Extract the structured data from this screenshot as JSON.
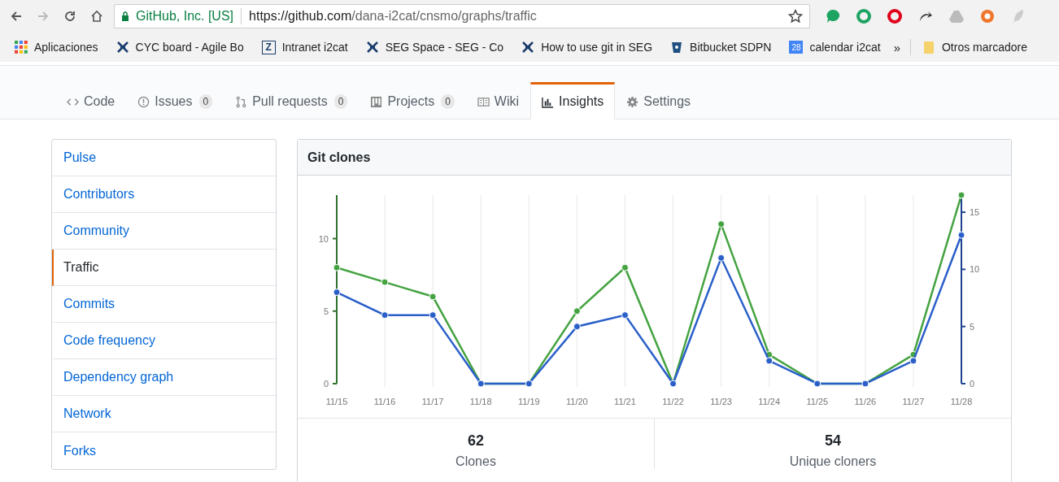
{
  "browser": {
    "site_identity": "GitHub, Inc. [US]",
    "url_host": "https://github.com",
    "url_path": "/dana-i2cat/cnsmo/graphs/traffic",
    "extensions": [
      {
        "kind": "bubble"
      },
      {
        "kind": "dring"
      },
      {
        "kind": "oring"
      },
      {
        "kind": "arrow"
      },
      {
        "kind": "drive"
      },
      {
        "kind": "lifebuoy"
      },
      {
        "kind": "feather"
      }
    ]
  },
  "bookmarks": [
    {
      "kind": "apps",
      "label": "Aplicaciones"
    },
    {
      "kind": "bug",
      "label": "CYC board - Agile Bo"
    },
    {
      "kind": "z",
      "label": "Intranet i2cat",
      "glyph": "Z"
    },
    {
      "kind": "bug",
      "label": "SEG Space - SEG - Co"
    },
    {
      "kind": "bug",
      "label": "How to use git in SEG"
    },
    {
      "kind": "bucket",
      "label": "Bitbucket SDPN"
    },
    {
      "kind": "calendar",
      "label": "calendar i2cat",
      "glyph": "28"
    }
  ],
  "bookmarks_more": "»",
  "other_bookmarks": "Otros marcadore",
  "tabs": [
    {
      "kind": "code",
      "label": "Code",
      "selected": false
    },
    {
      "kind": "issue",
      "label": "Issues",
      "count": "0",
      "selected": false
    },
    {
      "kind": "pr",
      "label": "Pull requests",
      "count": "0",
      "selected": false
    },
    {
      "kind": "project",
      "label": "Projects",
      "count": "0",
      "selected": false
    },
    {
      "kind": "wiki",
      "label": "Wiki",
      "selected": false
    },
    {
      "kind": "graph",
      "label": "Insights",
      "selected": true
    },
    {
      "kind": "gear",
      "label": "Settings",
      "selected": false
    }
  ],
  "sidebar": {
    "items": [
      {
        "label": "Pulse",
        "selected": false
      },
      {
        "label": "Contributors",
        "selected": false
      },
      {
        "label": "Community",
        "selected": false
      },
      {
        "label": "Traffic",
        "selected": true
      },
      {
        "label": "Commits",
        "selected": false
      },
      {
        "label": "Code frequency",
        "selected": false
      },
      {
        "label": "Dependency graph",
        "selected": false
      },
      {
        "label": "Network",
        "selected": false
      },
      {
        "label": "Forks",
        "selected": false
      }
    ]
  },
  "panel": {
    "title": "Git clones",
    "chart_data": {
      "type": "line",
      "categories": [
        "11/15",
        "11/16",
        "11/17",
        "11/18",
        "11/19",
        "11/20",
        "11/21",
        "11/22",
        "11/23",
        "11/24",
        "11/25",
        "11/26",
        "11/27",
        "11/28"
      ],
      "series": [
        {
          "color": "#44a340",
          "marker": true,
          "values": [
            8,
            7,
            6,
            0,
            0,
            5,
            8,
            0,
            11,
            2,
            0,
            0,
            2,
            13
          ]
        },
        {
          "color": "#2a5fc9",
          "axis": "y2",
          "marker": true,
          "values": [
            8,
            6,
            6,
            0,
            0,
            5,
            6,
            0,
            11,
            2,
            0,
            0,
            2,
            13
          ]
        }
      ],
      "grid": true,
      "ylim": [
        0,
        13
      ],
      "yticks": [
        0,
        5,
        10
      ],
      "y2lim": [
        0,
        16.5
      ],
      "y2ticks": [
        0,
        5,
        10,
        15
      ]
    },
    "stats": [
      {
        "value": "62",
        "label": "Clones"
      },
      {
        "value": "54",
        "label": "Unique cloners"
      }
    ]
  }
}
